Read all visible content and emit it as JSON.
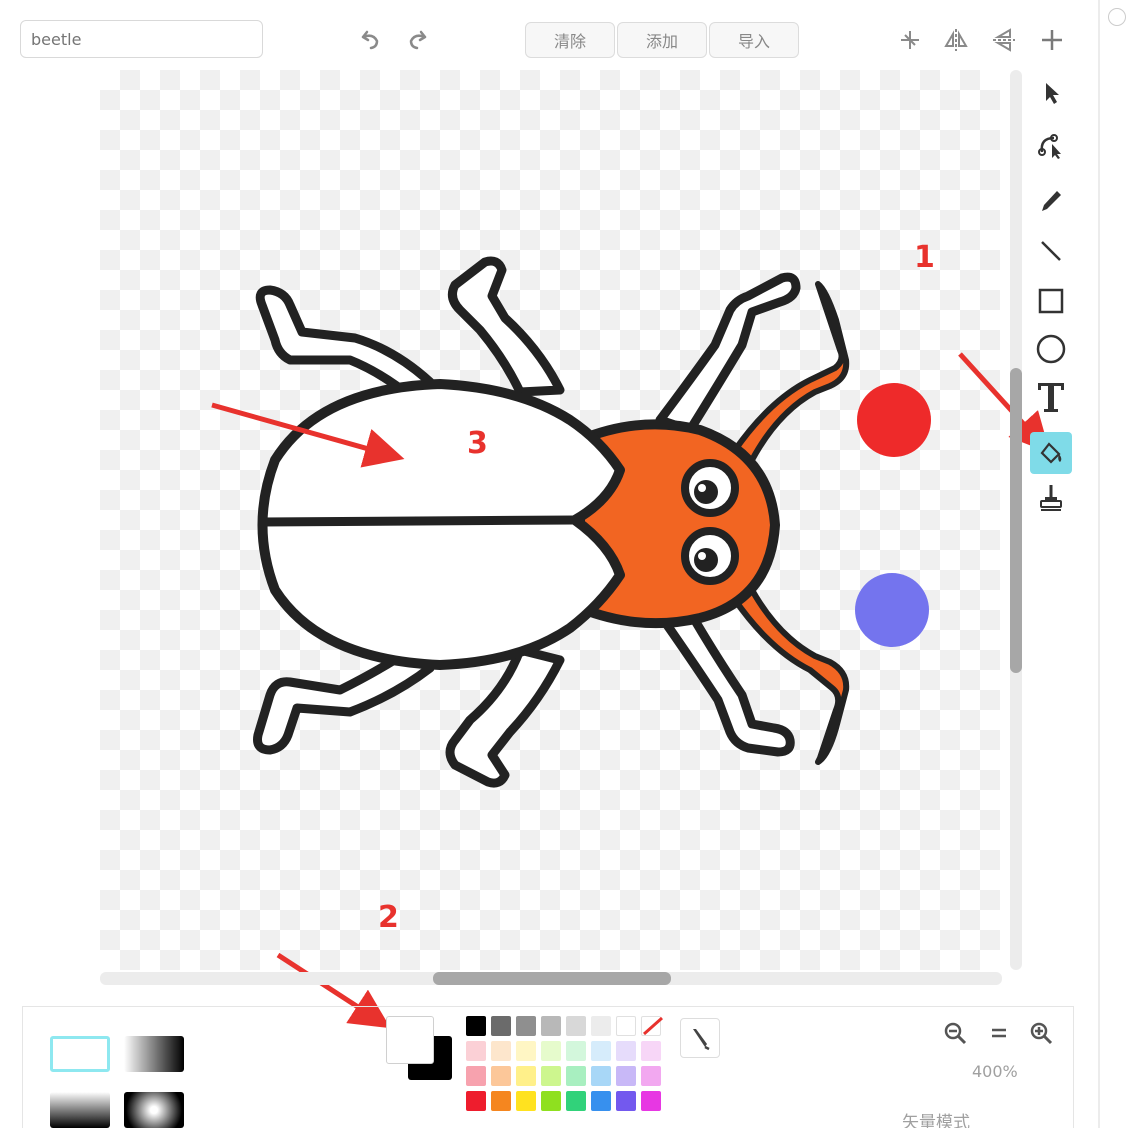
{
  "toolbar": {
    "costume_name_placeholder": "beetle",
    "clear_label": "清除",
    "add_label": "添加",
    "import_label": "导入",
    "undo_icon": "undo-icon",
    "redo_icon": "redo-icon",
    "crop_icon": "set-costume-center-icon",
    "flip_horizontal_icon": "flip-horizontal-icon",
    "flip_vertical_icon": "flip-vertical-icon",
    "add_icon": "plus-icon"
  },
  "tools": [
    {
      "name": "select-icon",
      "active": false
    },
    {
      "name": "reshape-icon",
      "active": false
    },
    {
      "name": "pencil-icon",
      "active": false
    },
    {
      "name": "line-icon",
      "active": false
    },
    {
      "name": "rectangle-icon",
      "active": false
    },
    {
      "name": "ellipse-icon",
      "active": false
    },
    {
      "name": "text-icon",
      "active": false
    },
    {
      "name": "fill-icon",
      "active": true
    },
    {
      "name": "stamp-icon",
      "active": false
    }
  ],
  "canvas_colors": {
    "beetle_head": "#f26522",
    "dot_red": "#ee2a2a",
    "dot_blue": "#7474ee",
    "outline": "#222222"
  },
  "palette": [
    "#000000",
    "#6b6b6b",
    "#8f8f8f",
    "#b8b8b8",
    "#d8d8d8",
    "#ececec",
    "#ffffff",
    "#ffffff",
    "#fbd0d6",
    "#fde6cc",
    "#fff6c4",
    "#e6fbcc",
    "#d3f7dc",
    "#d6ecfb",
    "#e6dcfb",
    "#f7d6f7",
    "#f7a2ae",
    "#fcc799",
    "#fff08a",
    "#cdf68e",
    "#a8efc0",
    "#a8d7f7",
    "#c8b8f7",
    "#f2a8f0",
    "#ee1d2d",
    "#f5861f",
    "#ffe21f",
    "#8fe01f",
    "#31d27a",
    "#3790ee",
    "#7359ee",
    "#e737e3"
  ],
  "zoom": {
    "level": "400%",
    "zoom_out_icon": "zoom-out-icon",
    "reset_icon": "zoom-reset-icon",
    "zoom_in_icon": "zoom-in-icon"
  },
  "footer": {
    "text": "矢量模式"
  },
  "annotations": {
    "label_1": "1",
    "label_2": "2",
    "label_3": "3",
    "color": "#e8322d"
  }
}
